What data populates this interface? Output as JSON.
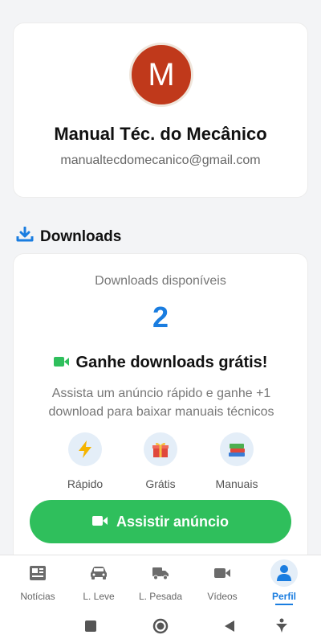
{
  "profile": {
    "avatar_letter": "M",
    "name": "Manual Téc. do Mecânico",
    "email": "manualtecdomecanico@gmail.com"
  },
  "downloads_section": {
    "title": "Downloads",
    "available_label": "Downloads disponíveis",
    "available_count": "2",
    "earn_title": "Ganhe downloads grátis!",
    "earn_description": "Assista um anúncio rápido e ganhe +1 download para baixar manuais técnicos",
    "features": [
      {
        "label": "Rápido",
        "icon": "lightning-icon"
      },
      {
        "label": "Grátis",
        "icon": "gift-icon"
      },
      {
        "label": "Manuais",
        "icon": "books-icon"
      }
    ],
    "watch_button_label": "Assistir anúncio"
  },
  "bottom_nav": {
    "items": [
      {
        "label": "Notícias",
        "icon": "newspaper-icon"
      },
      {
        "label": "L. Leve",
        "icon": "car-icon"
      },
      {
        "label": "L. Pesada",
        "icon": "truck-icon"
      },
      {
        "label": "Vídeos",
        "icon": "video-icon"
      },
      {
        "label": "Perfil",
        "icon": "person-icon",
        "active": true
      }
    ]
  },
  "colors": {
    "accent": "#1a7de0",
    "button_green": "#2fbf5c",
    "avatar": "#c0391b"
  }
}
